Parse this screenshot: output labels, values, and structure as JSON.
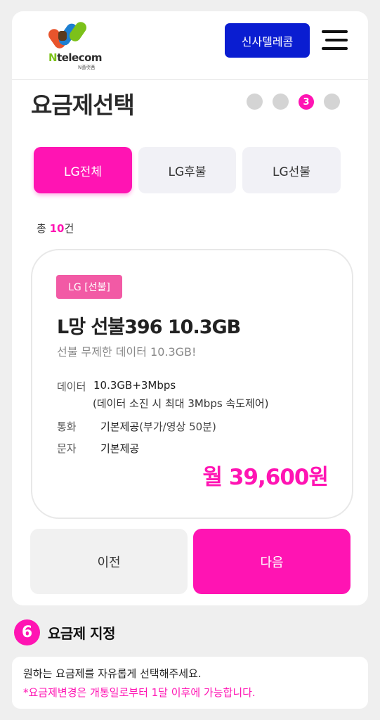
{
  "header": {
    "logo_text_prefix": "N",
    "logo_text_rest": "telecom",
    "logo_sub": "N플랫폼",
    "shop_button_label": "신사텔레콤"
  },
  "step": {
    "title": "요금제선택",
    "current_step_label": "3",
    "total_dots": 4,
    "active_index": 2
  },
  "tabs": [
    {
      "label": "LG전체",
      "active": true
    },
    {
      "label": "LG후불",
      "active": false
    },
    {
      "label": "LG선불",
      "active": false
    }
  ],
  "total": {
    "prefix": "총",
    "count": "10",
    "suffix": "건"
  },
  "plan": {
    "badge": "LG [선불]",
    "name": "L망 선불396 10.3GB",
    "description": "선불 무제한 데이터 10.3GB!",
    "data_label": "데이터",
    "data_value": "10.3GB+3Mbps",
    "data_note": "(데이터 소진 시 최대 3Mbps 속도제어)",
    "call_label": "통화",
    "call_value": "기본제공",
    "call_note": "(부가/영상 50분)",
    "sms_label": "문자",
    "sms_value": "기본제공",
    "price": "월 39,600원"
  },
  "nav": {
    "prev_label": "이전",
    "next_label": "다음"
  },
  "section": {
    "number": "6",
    "title": "요금제 지정",
    "info_line1": "원하는 요금제를 자유롭게 선택해주세요.",
    "info_line2": "*요금제변경은 개통일로부터 1달 이후에 가능합니다."
  },
  "colors": {
    "accent": "#ff14b3",
    "brand_blue": "#0a1dd1",
    "badge": "#f25aa5"
  }
}
